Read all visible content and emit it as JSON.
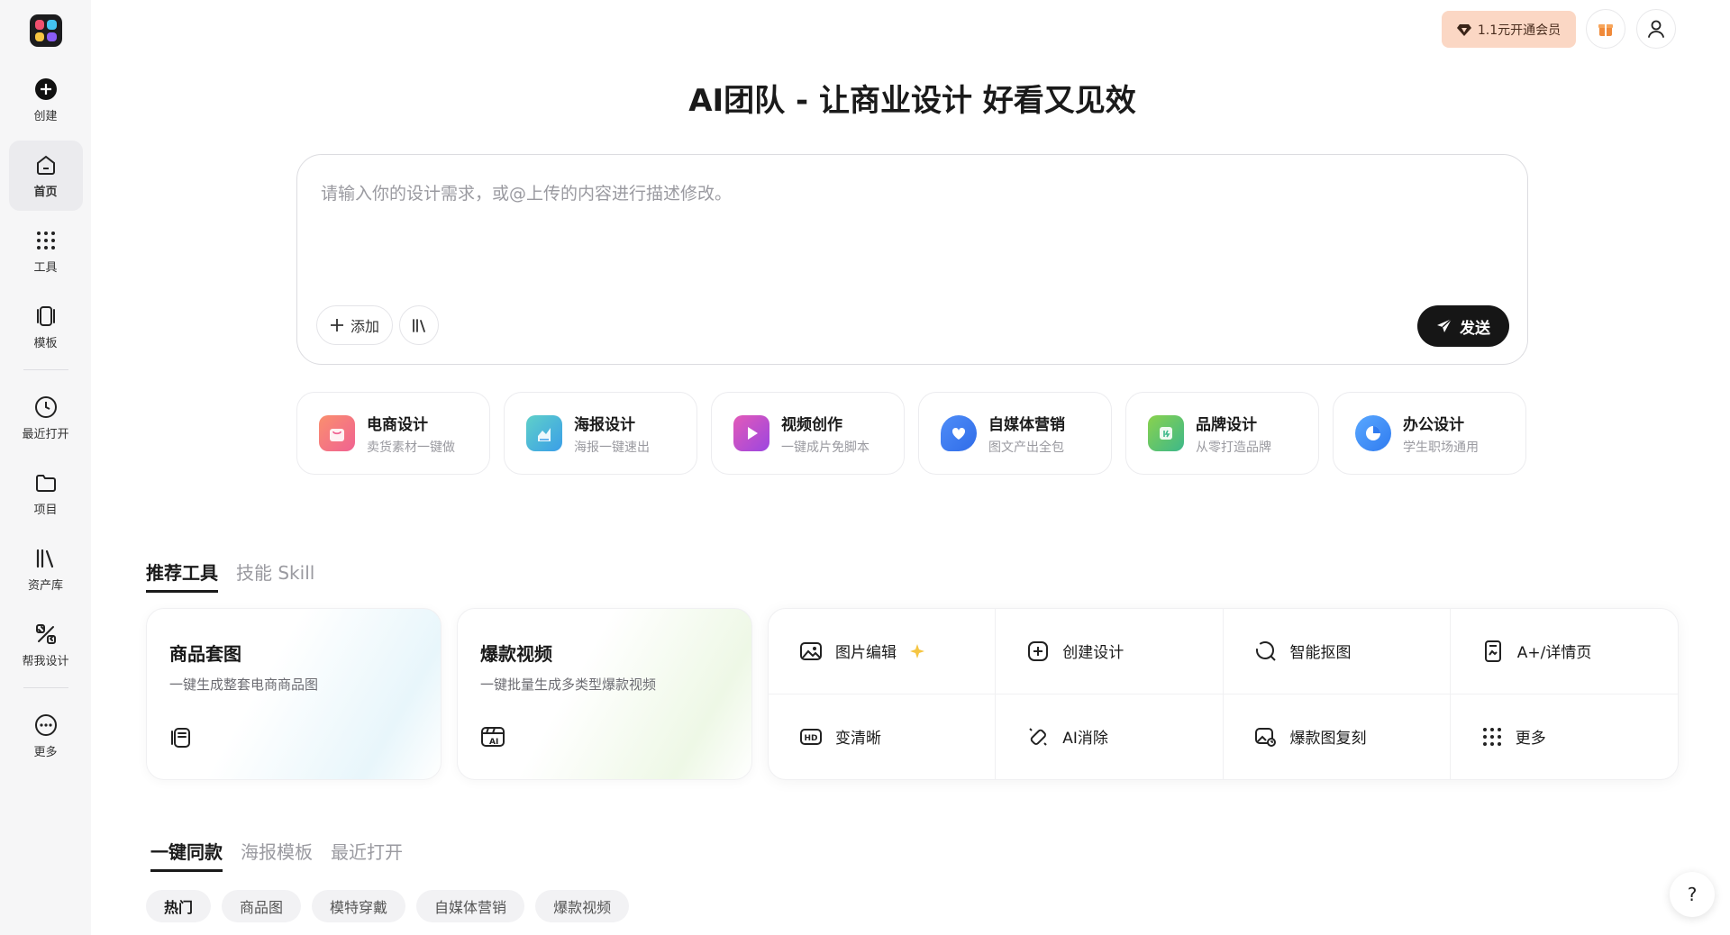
{
  "sidebar": {
    "items": [
      {
        "label": "创建"
      },
      {
        "label": "首页"
      },
      {
        "label": "工具"
      },
      {
        "label": "模板"
      },
      {
        "label": "最近打开"
      },
      {
        "label": "项目"
      },
      {
        "label": "资产库"
      },
      {
        "label": "帮我设计"
      },
      {
        "label": "更多"
      }
    ],
    "active_index": 1
  },
  "header": {
    "vip_label": "1.1元开通会员"
  },
  "hero": {
    "title": "AI团队 - 让商业设计 好看又见效"
  },
  "prompt": {
    "placeholder": "请输入你的设计需求，或@上传的内容进行描述修改。",
    "value": "",
    "add_label": "添加",
    "send_label": "发送"
  },
  "categories": [
    {
      "title": "电商设计",
      "sub": "卖货素材一键做",
      "color": "#f47a6a"
    },
    {
      "title": "海报设计",
      "sub": "海报一键速出",
      "color": "#4bb8e0"
    },
    {
      "title": "视频创作",
      "sub": "一键成片免脚本",
      "color": "#c44ad6"
    },
    {
      "title": "自媒体营销",
      "sub": "图文产出全包",
      "color": "#3d7bf0"
    },
    {
      "title": "品牌设计",
      "sub": "从零打造品牌",
      "color": "#58c06d"
    },
    {
      "title": "办公设计",
      "sub": "学生职场通用",
      "color": "#3b8cf5"
    }
  ],
  "tool_tabs": [
    {
      "label": "推荐工具"
    },
    {
      "label": "技能 Skill"
    }
  ],
  "features": [
    {
      "title": "商品套图",
      "sub": "一键生成整套电商商品图",
      "icon": "product-set-icon"
    },
    {
      "title": "爆款视频",
      "sub": "一键批量生成多类型爆款视频",
      "icon": "ai-video-icon"
    }
  ],
  "tools": [
    {
      "label": "图片编辑",
      "icon": "image-edit-icon"
    },
    {
      "label": "创建设计",
      "icon": "plus-square-icon"
    },
    {
      "label": "智能抠图",
      "icon": "cutout-icon"
    },
    {
      "label": "A+/详情页",
      "icon": "detail-page-icon"
    },
    {
      "label": "变清晰",
      "icon": "hd-icon"
    },
    {
      "label": "AI消除",
      "icon": "eraser-icon"
    },
    {
      "label": "爆款图复刻",
      "icon": "replicate-icon"
    },
    {
      "label": "更多",
      "icon": "grid-dots-icon"
    }
  ],
  "template_tabs": [
    {
      "label": "一键同款"
    },
    {
      "label": "海报模板"
    },
    {
      "label": "最近打开"
    }
  ],
  "chips": [
    {
      "label": "热门"
    },
    {
      "label": "商品图"
    },
    {
      "label": "模特穿戴"
    },
    {
      "label": "自媒体营销"
    },
    {
      "label": "爆款视频"
    }
  ],
  "help_label": "?"
}
